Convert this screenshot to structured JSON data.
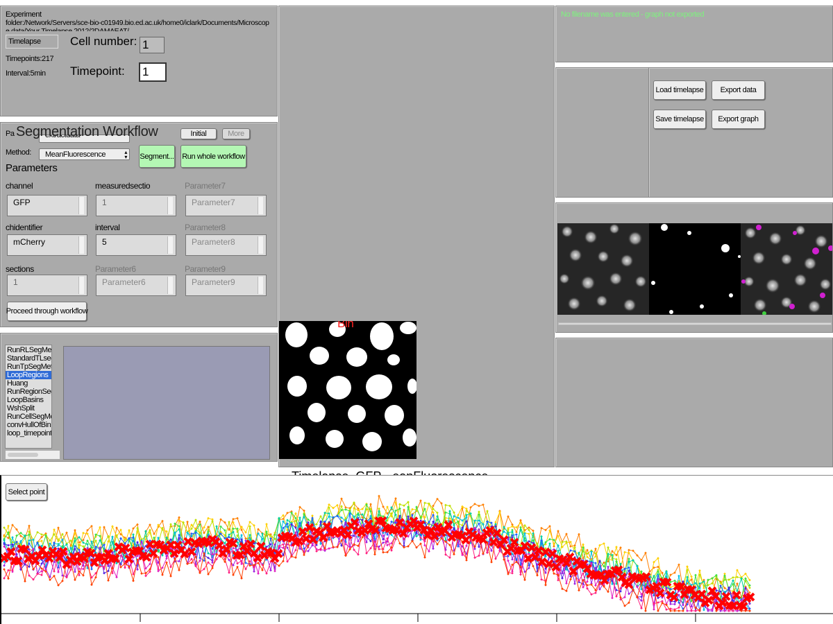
{
  "experiment": {
    "folder_label": "Experiment",
    "folder_path_line1": "folder:/Network/Servers/sce-bio-c01949.bio.ed.ac.uk/home0/iclark/Documents/Microscop",
    "folder_path_line2": "e data/Your Timelapse 2012/2DAMAEAT/...",
    "type_label": "Timelapse",
    "timepoints": "Timepoints:217",
    "interval": "Interval:5min",
    "cell_number_label": "Cell number:",
    "cell_number_value": "1",
    "timepoint_label": "Timepoint:",
    "timepoint_value": "1"
  },
  "workflow": {
    "title": "Segmentation Workflow",
    "party_label": "Pa",
    "party_value": "extractdata",
    "initial_button": "Initial",
    "more_button": "More",
    "method_label": "Method:",
    "method_value": "MeanFluorescence",
    "segment_button": "Segment...",
    "run_whole_button": "Run whole workflow",
    "parameters_title": "Parameters",
    "params": [
      {
        "label": "channel",
        "value": "GFP",
        "enabled": true
      },
      {
        "label": "measuredsectio",
        "value": "1",
        "enabled": true
      },
      {
        "label": "Parameter7",
        "value": "Parameter7",
        "enabled": false
      },
      {
        "label": "chidentifier",
        "value": "mCherry",
        "enabled": true
      },
      {
        "label": "interval",
        "value": "5",
        "enabled": true
      },
      {
        "label": "Parameter8",
        "value": "Parameter8",
        "enabled": false
      },
      {
        "label": "sections",
        "value": "1",
        "enabled": true
      },
      {
        "label": "Parameter6",
        "value": "Parameter6",
        "enabled": false
      },
      {
        "label": "Parameter9",
        "value": "Parameter9",
        "enabled": false
      }
    ],
    "proceed_button": "Proceed through workflow"
  },
  "methods_list": {
    "items": [
      "RunRLSegMeth",
      "StandardTLseg",
      "RunTpSegMeth",
      "LoopRegions",
      "Huang",
      "RunRegionSegM",
      "LoopBasins",
      "WshSplit",
      "RunCellSegMet",
      "convHullOfBin",
      "loop_timepoints"
    ],
    "selected_index": 3
  },
  "bin_image": {
    "title": "Bin"
  },
  "status": {
    "message": "No filename was entered - graph not exported"
  },
  "file_buttons": {
    "load_timelapse": "Load timelapse",
    "export_data": "Export data",
    "save_timelapse": "Save timelapse",
    "export_graph": "Export graph"
  },
  "graph": {
    "title_part1": "Timelapse",
    "title_part2": "GFP",
    "title_sub": "M",
    "title_part3": "eanFluorescence",
    "select_point_button": "Select point"
  },
  "colors": {
    "panel_bg": "#aaaaaa",
    "status_text": "#7ef27e",
    "green_button": "#b4f7b4",
    "list_selection": "#2f6bd6",
    "preview_bg": "#9a9bb4",
    "bin_title": "#ff2020",
    "highlight_trace": "#ff0000"
  }
}
